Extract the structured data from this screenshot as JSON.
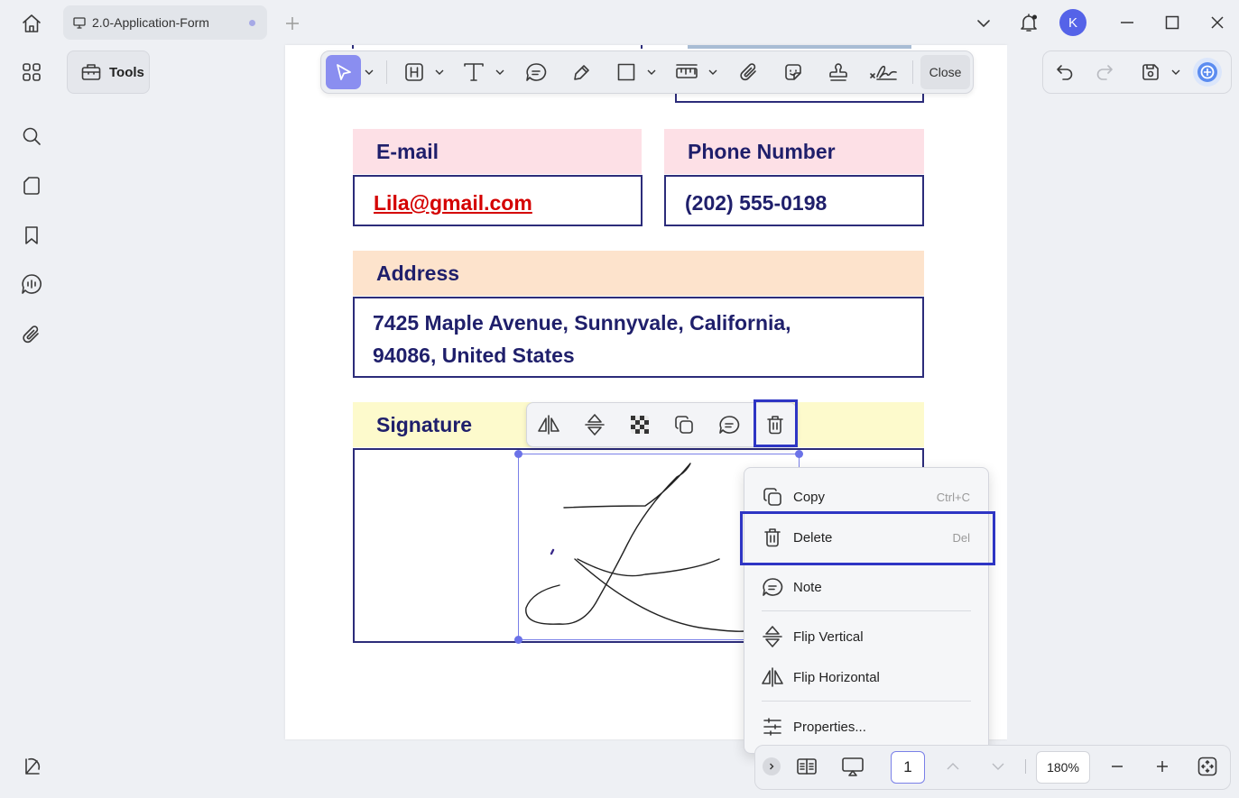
{
  "tab": {
    "title": "2.0-Application-Form"
  },
  "user": {
    "avatar_letter": "K"
  },
  "toolbar": {
    "tools_label": "Tools",
    "close_label": "Close"
  },
  "form": {
    "email_label": "E-mail",
    "email_value": "Lila@gmail.com",
    "phone_label": "Phone Number",
    "phone_value": "(202) 555-0198",
    "address_label": "Address",
    "address_line1": "7425 Maple Avenue, Sunnyvale, California,",
    "address_line2": "94086, United States",
    "signature_label": "Signature"
  },
  "context_menu": {
    "items": [
      {
        "label": "Copy",
        "shortcut": "Ctrl+C",
        "icon": "copy-icon"
      },
      {
        "label": "Delete",
        "shortcut": "Del",
        "icon": "trash-icon"
      },
      {
        "label": "Note",
        "shortcut": "",
        "icon": "comment-icon"
      },
      {
        "label": "Flip Vertical",
        "shortcut": "",
        "icon": "flip-vertical-icon"
      },
      {
        "label": "Flip Horizontal",
        "shortcut": "",
        "icon": "flip-horizontal-icon"
      },
      {
        "label": "Properties...",
        "shortcut": "",
        "icon": "sliders-icon"
      }
    ]
  },
  "bottom": {
    "page_number": "1",
    "zoom": "180%"
  },
  "colors": {
    "accent": "#8a8ef0",
    "highlight": "#2e35c4",
    "form_text": "#1f1f6b",
    "email_link": "#d40000"
  }
}
